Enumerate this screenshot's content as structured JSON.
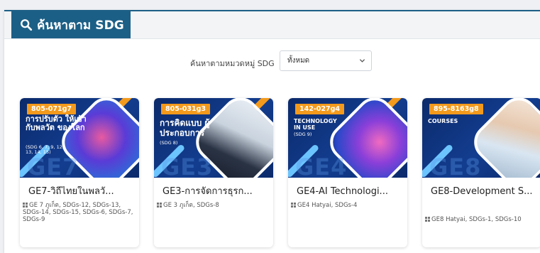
{
  "header": {
    "title": "ค้นหาตาม SDG"
  },
  "filter": {
    "label": "ค้นหาตามหมวดหมู่ SDG",
    "selected": "ทั้งหมด"
  },
  "courses": [
    {
      "code": "805-071g7",
      "thumb_heading": "การปรับตัว ให้เข้ากับพลวัต ของโลก",
      "thumb_sub": "(SDG 6, 7, 9, 12, 13, 14, 15)",
      "watermark": "GE7",
      "title": "GE7-วิถีไทยในพลวั...",
      "meta": "GE 7 ภูเก็ต, SDGs-12, SDGs-13, SDGs-14, SDGs-15, SDGs-6, SDGs-7, SDGs-9"
    },
    {
      "code": "805-031g3",
      "thumb_heading": "การคิดแบบ ผู้ประกอบการ",
      "thumb_sub": "(SDG 8)",
      "watermark": "GE3",
      "title": "GE3-การจัดการธุรก...",
      "meta": "GE 3 ภูเก็ต, SDGs-8"
    },
    {
      "code": "142-027g4",
      "thumb_heading": "TECHNOLOGY IN USE",
      "thumb_sub": "(SDG 9)",
      "watermark": "GE4",
      "title": "GE4-AI Technologi...",
      "meta": "GE4 Hatyai, SDGs-4"
    },
    {
      "code": "895-8163g8",
      "thumb_heading": "COURSES",
      "thumb_sub": "",
      "watermark": "GE8",
      "title": "GE8-Development S...",
      "meta": "GE8 Hatyai, SDGs-1, SDGs-10"
    }
  ],
  "colors": {
    "brand": "#1c5f86",
    "badge": "#f39a1c",
    "thumb_bg": "#0b2a6b"
  }
}
